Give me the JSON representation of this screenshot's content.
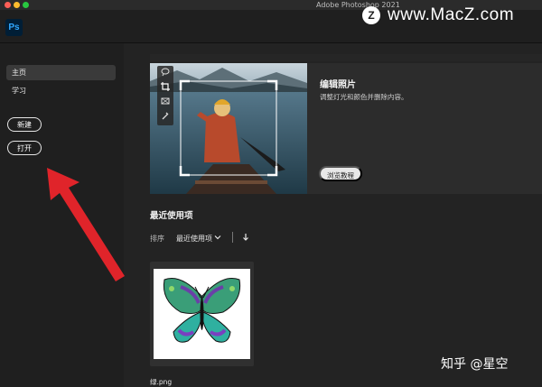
{
  "window": {
    "title": "Adobe Photoshop 2021"
  },
  "watermark": {
    "top_logo": "Z",
    "top_text": "www.MacZ.com",
    "bottom_text": "知乎 @星空"
  },
  "app": {
    "logo_text": "Ps"
  },
  "sidebar": {
    "items": [
      {
        "label": "主页"
      },
      {
        "label": "学习"
      }
    ],
    "new_button": "新建",
    "open_button": "打开"
  },
  "card": {
    "title": "编辑照片",
    "description": "调整灯光和颜色并删除内容。",
    "tutorial_button": "浏览教程"
  },
  "recent": {
    "title": "最近使用项",
    "sort_label": "排序",
    "sort_value": "最近使用项",
    "file": {
      "name": "绿.png"
    }
  },
  "colors": {
    "accent_ps": "#31a8ff",
    "arrow": "#e0242a",
    "background": "#1f1f1f"
  }
}
